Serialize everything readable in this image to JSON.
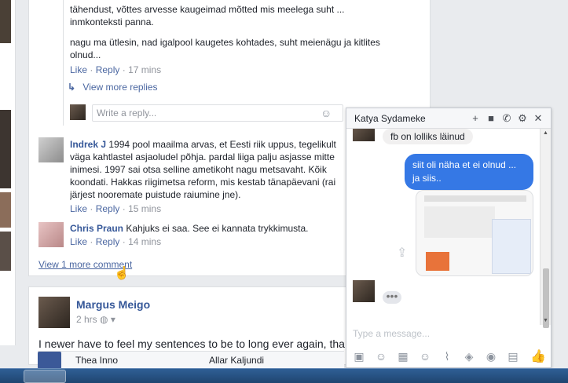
{
  "thread": {
    "cut_line": "tähendust, võttes arvesse kaugeimad mõtted mis meelega suht ...",
    "cut_line2": "inmkonteksti panna.",
    "para": "nagu ma ütlesin, nad igalpool kaugetes kohtades, suht meienägu ja kitlites olnud...",
    "like": "Like",
    "reply": "Reply",
    "time1": "17 mins",
    "view_more_replies": "View more replies",
    "reply_placeholder": "Write a reply..."
  },
  "comments": [
    {
      "name": "Indrek J",
      "text": "1994 pool maailma arvas, et Eesti riik uppus, tegelikult väga kahtlastel asjaoludel põhja. pardal liiga palju asjasse mitte inimesi. 1997 sai otsa selline ametikoht nagu metsavaht. Kõik koondati. Hakkas riigimetsa reform, mis kestab tänapäevani (rai järjest nooremate puistude raiumine jne).",
      "time": "15 mins"
    },
    {
      "name": "Chris Praun",
      "text": "Kahjuks ei saa. See ei kannata trykkimustа.",
      "time": "14 mins"
    }
  ],
  "view_more_comment": "View 1 more comment",
  "post2": {
    "author": "Margus Meigo",
    "time": "2 hrs",
    "text": "I newer have to feel my sentences to be to long ever again, tha"
  },
  "chat": {
    "title": "Katya Sydameke",
    "msg_in": "fb on lolliks läinud",
    "msg_out": "siit oli näha et ei olnud ... ja siis..",
    "placeholder": "Type a message..."
  },
  "bottom": {
    "item1": "Thea Inno",
    "item2": "Allar Kaljundi"
  },
  "colors": {
    "link": "#365899",
    "bubble_out": "#3578e5",
    "bg": "#e9ebee"
  }
}
